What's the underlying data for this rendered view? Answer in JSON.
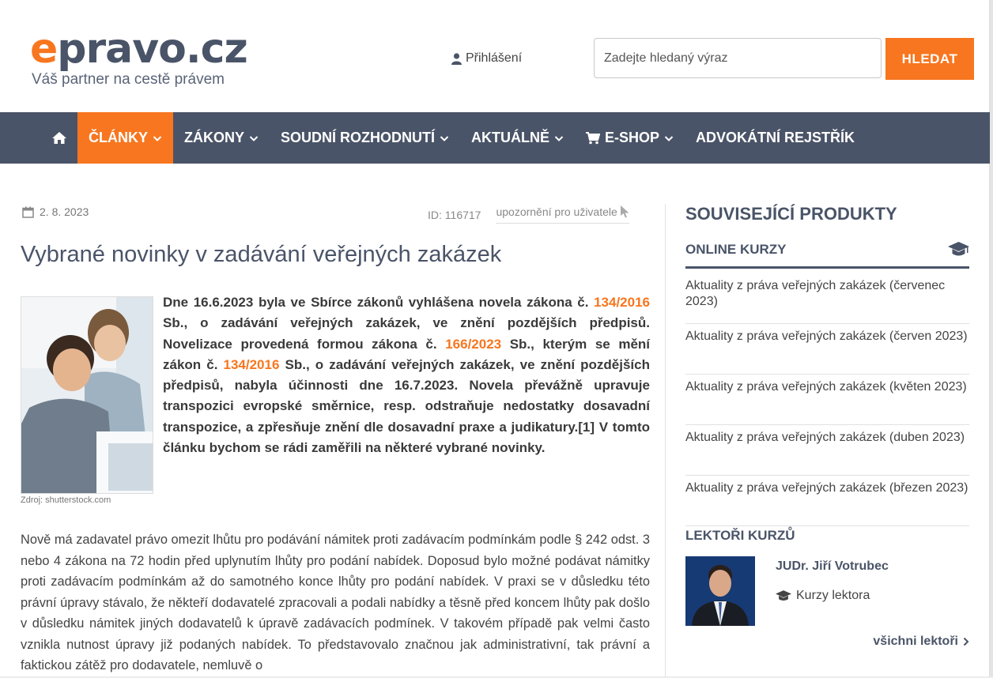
{
  "header": {
    "logo_e": "e",
    "logo_rest": "pravo.cz",
    "tagline": "Váš partner na cestě právem",
    "login_label": "Přihlášení",
    "search_placeholder": "Zadejte hledaný výraz",
    "search_button": "HLEDAT"
  },
  "nav": {
    "items": [
      {
        "label": "ČLÁNKY"
      },
      {
        "label": "ZÁKONY"
      },
      {
        "label": "SOUDNÍ ROZHODNUTÍ"
      },
      {
        "label": "AKTUÁLNĚ"
      },
      {
        "label": "E-SHOP"
      },
      {
        "label": "ADVOKÁTNÍ REJSTŘÍK"
      }
    ],
    "accent": "#f7761f",
    "bar_color": "#4a5468"
  },
  "article": {
    "date": "2. 8. 2023",
    "id_label": "ID: 116717",
    "warning_link": "upozornění pro uživatele",
    "title": "Vybrané novinky v zadávání veřejných zakázek",
    "photo_credit": "Zdroj: shutterstock.com",
    "perex": {
      "t1": "Dne 16.6.2023 byla ve Sbírce zákonů vyhlášena novela zákona č. ",
      "l1": "134/2016",
      "t2": " Sb., o zadávání veřejných zakázek, ve znění pozdějších předpisů. Novelizace provedená formou zákona č. ",
      "l2": "166/2023",
      "t3": " Sb., kterým se mění zákon č. ",
      "l3": "134/2016",
      "t4": " Sb., o zadávání veřejných zakázek, ve znění pozdějších předpisů, nabyla účinnosti dne 16.7.2023. Novela převážně upravuje transpozici evropské směrnice, resp. odstraňuje nedostatky dosavadní transpozice, a zpřesňuje znění dle dosavadní praxe a judikatury.[1] V tomto článku bychom se rádi zaměřili na některé vybrané novinky."
    },
    "body": "Nově má zadavatel právo omezit lhůtu pro podávání námitek proti zadávacím podmínkám podle § 242 odst. 3 nebo 4 zákona na 72 hodin před uplynutím lhůty pro podání nabídek. Doposud bylo možné podávat námitky proti zadávacím podmínkám až do samotného konce lhůty pro podání nabídek. V praxi se v důsledku této právní úpravy stávalo, že někteří dodavatelé zpracovali a podali nabídky a těsně před koncem lhůty pak došlo v důsledku námitek jiných dodavatelů k úpravě zadávacích podmínek. V takovém případě pak velmi často vznikla nutnost úpravy již podaných nabídek. To představovalo značnou jak administrativní, tak právní a faktickou zátěž pro dodavatele, nemluvě o"
  },
  "sidebar": {
    "title": "SOUVISEJÍCÍ PRODUKTY",
    "online_title": "ONLINE KURZY",
    "courses": [
      {
        "label": "Aktuality z práva veřejných zakázek (červenec 2023)"
      },
      {
        "label": "Aktuality z práva veřejných zakázek (červen 2023)"
      },
      {
        "label": "Aktuality z práva veřejných zakázek (květen 2023)"
      },
      {
        "label": "Aktuality z práva veřejných zakázek (duben 2023)"
      },
      {
        "label": "Aktuality z práva veřejných zakázek (březen 2023)"
      }
    ],
    "lecturers_title": "LEKTOŘI KURZŮ",
    "lecturer_name": "JUDr. Jiří Votrubec",
    "lecturer_courses": "Kurzy lektora",
    "all_lecturers": "všichni lektoři"
  }
}
